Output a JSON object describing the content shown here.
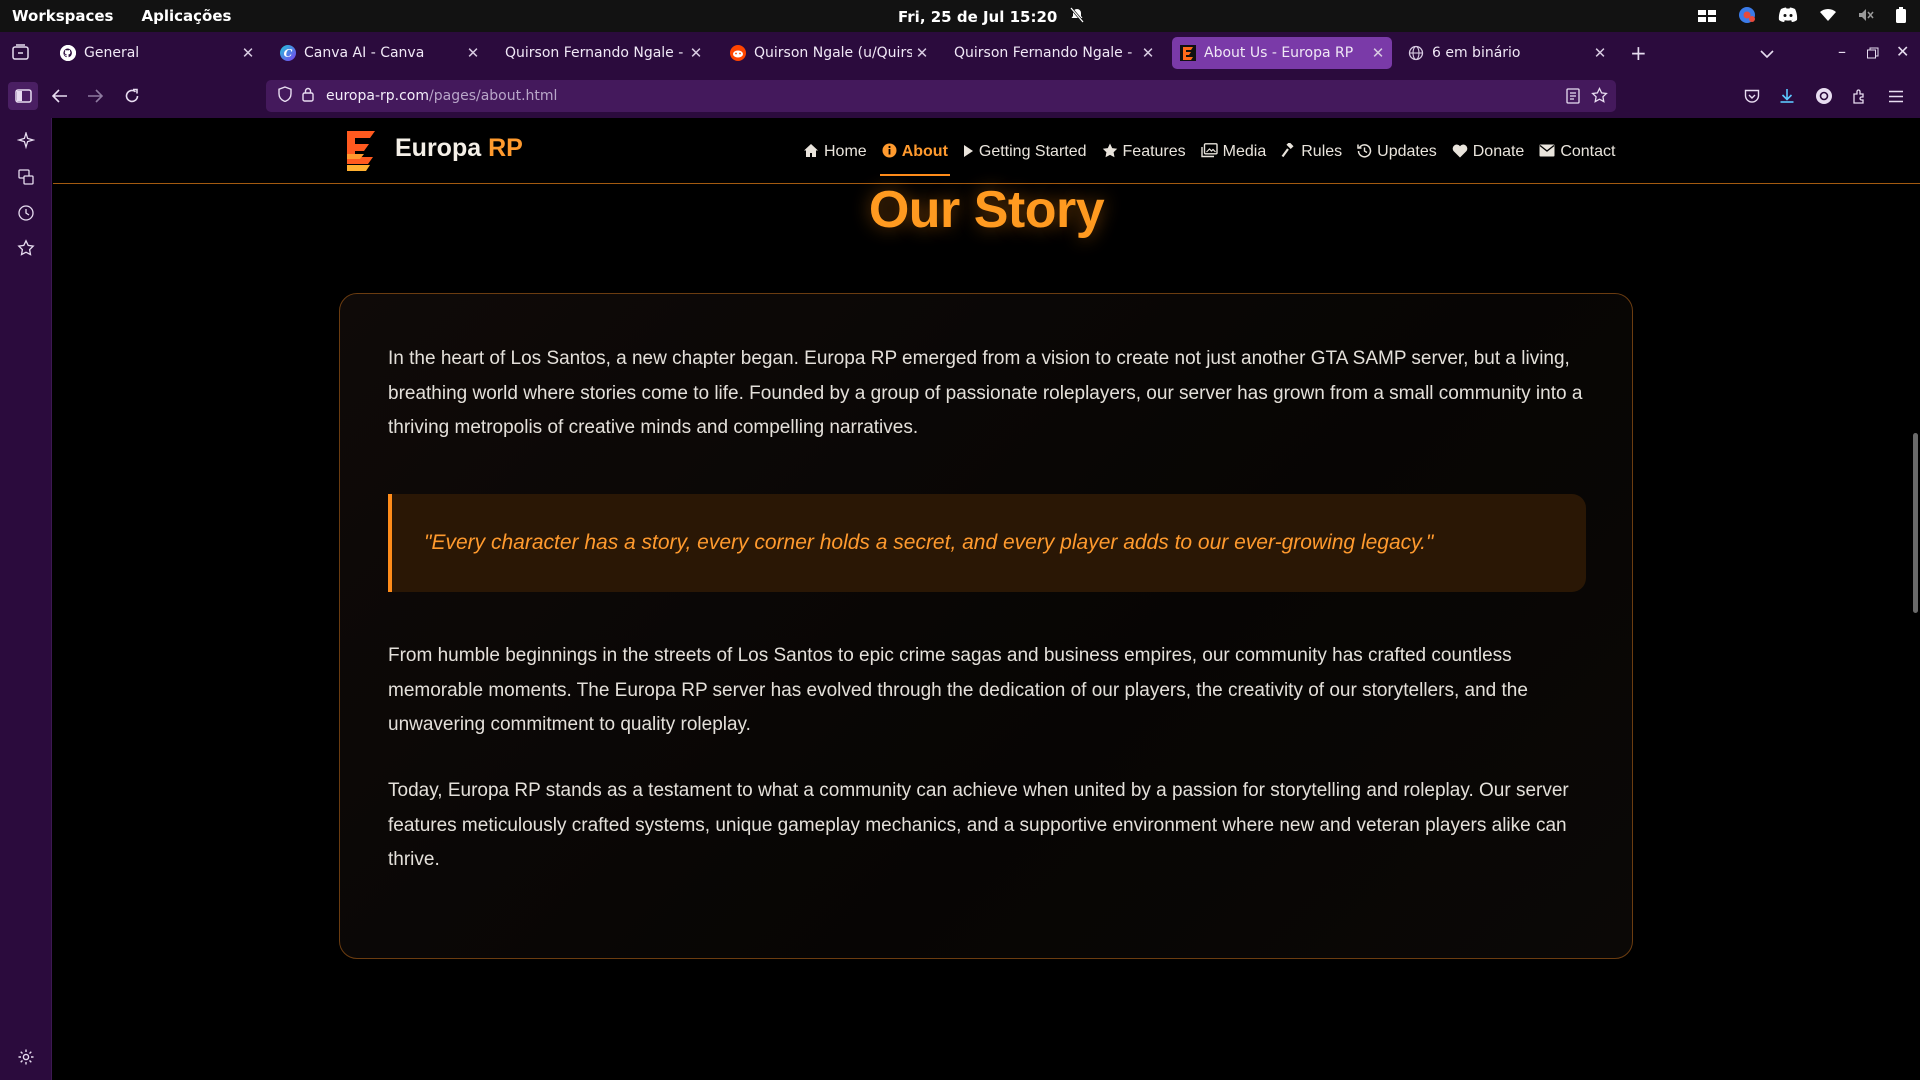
{
  "system_bar": {
    "workspaces": "Workspaces",
    "applications": "Aplicações",
    "clock": "Fri, 25 de Jul  15:20"
  },
  "tabs": [
    {
      "title": "General",
      "favicon": "github-icon",
      "active": false
    },
    {
      "title": "Canva AI - Canva",
      "favicon": "canva-icon",
      "active": false
    },
    {
      "title": "Quirson Fernando Ngale - Full S",
      "favicon": "none",
      "active": false
    },
    {
      "title": "Quirson Ngale (u/Quirson_I",
      "favicon": "reddit-icon",
      "active": false
    },
    {
      "title": "Quirson Fernando Ngale - Dese",
      "favicon": "none",
      "active": false
    },
    {
      "title": "About Us - Europa RP",
      "favicon": "europa-icon",
      "active": true
    },
    {
      "title": "6 em binário",
      "favicon": "globe-icon",
      "active": false
    }
  ],
  "url": {
    "host": "europa-rp.com",
    "path": "/pages/about.html"
  },
  "site": {
    "brand_main": "Europa",
    "brand_accent": "RP",
    "nav": [
      {
        "label": "Home",
        "icon": "home-icon",
        "active": false
      },
      {
        "label": "About",
        "icon": "info-icon",
        "active": true
      },
      {
        "label": "Getting Started",
        "icon": "play-icon",
        "active": false
      },
      {
        "label": "Features",
        "icon": "star-icon",
        "active": false
      },
      {
        "label": "Media",
        "icon": "images-icon",
        "active": false
      },
      {
        "label": "Rules",
        "icon": "gavel-icon",
        "active": false
      },
      {
        "label": "Updates",
        "icon": "history-icon",
        "active": false
      },
      {
        "label": "Donate",
        "icon": "heart-icon",
        "active": false
      },
      {
        "label": "Contact",
        "icon": "envelope-icon",
        "active": false
      }
    ],
    "colors": {
      "accent": "#ff9a2e",
      "browser_chrome": "#2b0b3d",
      "active_tab": "#7a3aa8"
    }
  },
  "story": {
    "title": "Our Story",
    "paragraph_1": "In the heart of Los Santos, a new chapter began. Europa RP emerged from a vision to create not just another GTA SAMP server, but a living, breathing world where stories come to life. Founded by a group of passionate roleplayers, our server has grown from a small community into a thriving metropolis of creative minds and compelling narratives.",
    "quote": "\"Every character has a story, every corner holds a secret, and every player adds to our ever-growing legacy.\"",
    "paragraph_2": "From humble beginnings in the streets of Los Santos to epic crime sagas and business empires, our community has crafted countless memorable moments. The Europa RP server has evolved through the dedication of our players, the creativity of our storytellers, and the unwavering commitment to quality roleplay.",
    "paragraph_3": "Today, Europa RP stands as a testament to what a community can achieve when united by a passion for storytelling and roleplay. Our server features meticulously crafted systems, unique gameplay mechanics, and a supportive environment where new and veteran players alike can thrive."
  }
}
